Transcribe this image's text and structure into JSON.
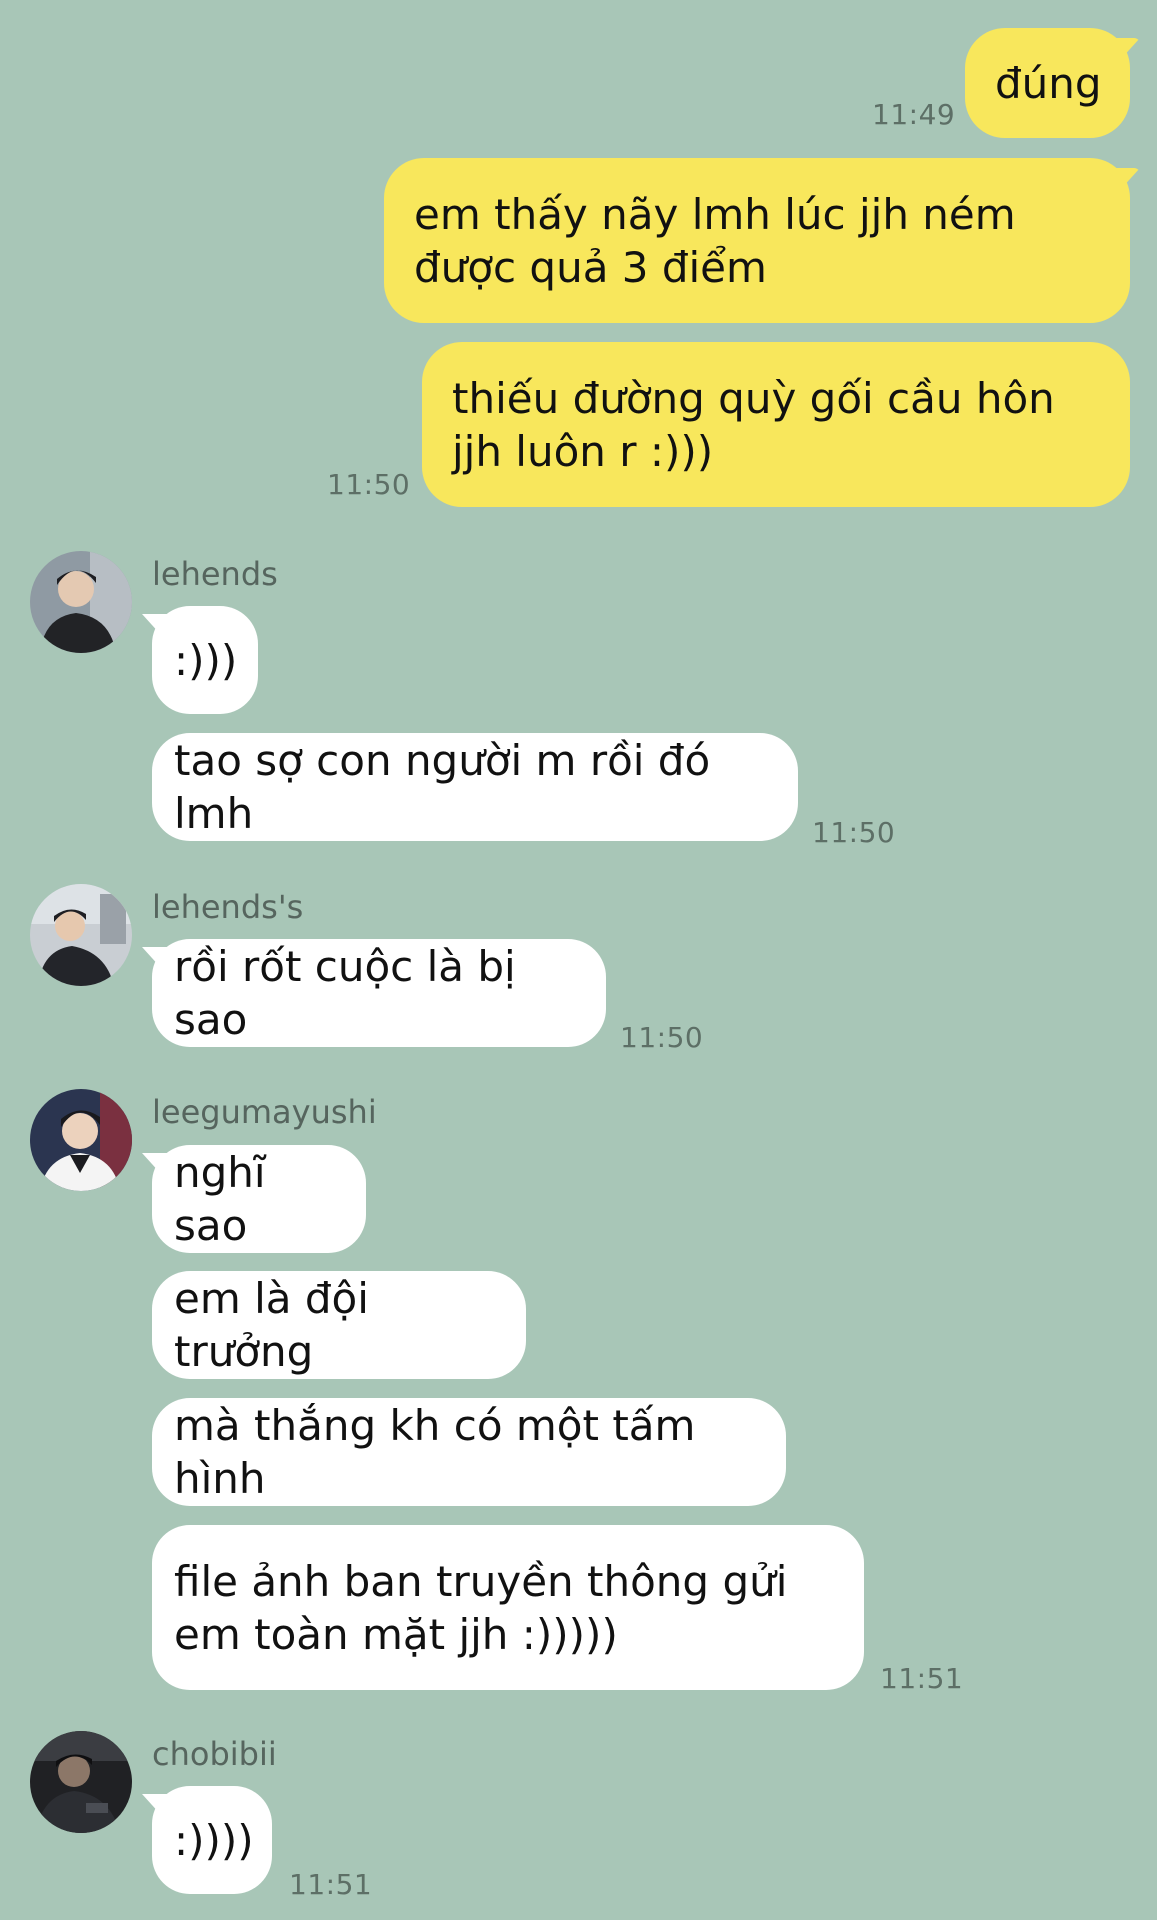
{
  "chat": {
    "outgoing": [
      {
        "text": "đúng",
        "time": "11:49"
      },
      {
        "text": "em thấy nãy lmh lúc jjh ném được quả 3 điểm"
      },
      {
        "text": "thiếu đường quỳ gối cầu hôn jjh luôn r :)))",
        "time": "11:50"
      }
    ],
    "groups": [
      {
        "sender": "lehends",
        "avatar_icon": "profile-photo-icon",
        "messages": [
          {
            "text": ":)))"
          },
          {
            "text": "tao sợ con người m rồi đó lmh",
            "time": "11:50"
          }
        ]
      },
      {
        "sender": "lehends's",
        "avatar_icon": "profile-photo-icon",
        "messages": [
          {
            "text": "rồi rốt cuộc là bị sao",
            "time": "11:50"
          }
        ]
      },
      {
        "sender": "leegumayushi",
        "avatar_icon": "profile-photo-icon",
        "messages": [
          {
            "text": "nghĩ sao"
          },
          {
            "text": "em là đội trưởng"
          },
          {
            "text": "mà thắng kh có một tấm hình"
          },
          {
            "text": "file ảnh ban truyền thông gửi em toàn mặt jjh :)))))",
            "time": "11:51"
          }
        ]
      },
      {
        "sender": "chobibii",
        "avatar_icon": "profile-photo-icon",
        "messages": [
          {
            "text": ":))))",
            "time": "11:51"
          }
        ]
      }
    ]
  },
  "colors": {
    "background": "#a8c6b7",
    "outgoing_bubble": "#f8e75c",
    "incoming_bubble": "#ffffff"
  }
}
